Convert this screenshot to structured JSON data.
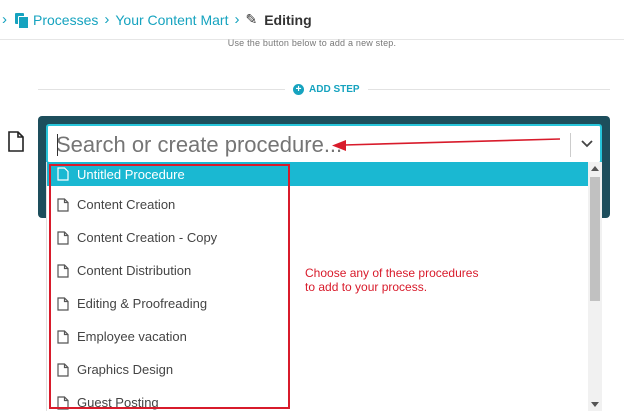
{
  "breadcrumb": {
    "items": [
      {
        "label": "Processes"
      },
      {
        "label": "Your Content Mart"
      }
    ],
    "current": "Editing"
  },
  "hint_text": "Use the button below to add a new step.",
  "add_step_label": "ADD STEP",
  "search": {
    "placeholder": "Search or create procedure..."
  },
  "dropdown": {
    "options": [
      {
        "label": "Untitled Procedure",
        "selected": true
      },
      {
        "label": "Content Creation"
      },
      {
        "label": "Content Creation - Copy"
      },
      {
        "label": "Content Distribution"
      },
      {
        "label": "Editing & Proofreading"
      },
      {
        "label": "Employee vacation"
      },
      {
        "label": "Graphics Design"
      },
      {
        "label": "Guest Posting"
      }
    ]
  },
  "annotation": {
    "line1": "Choose any of these procedures",
    "line2": "to add to your process."
  },
  "colors": {
    "accent": "#16a3bf",
    "selected": "#1ab8d2",
    "frame": "#1d4e5c",
    "annotation": "#d81b2b"
  }
}
